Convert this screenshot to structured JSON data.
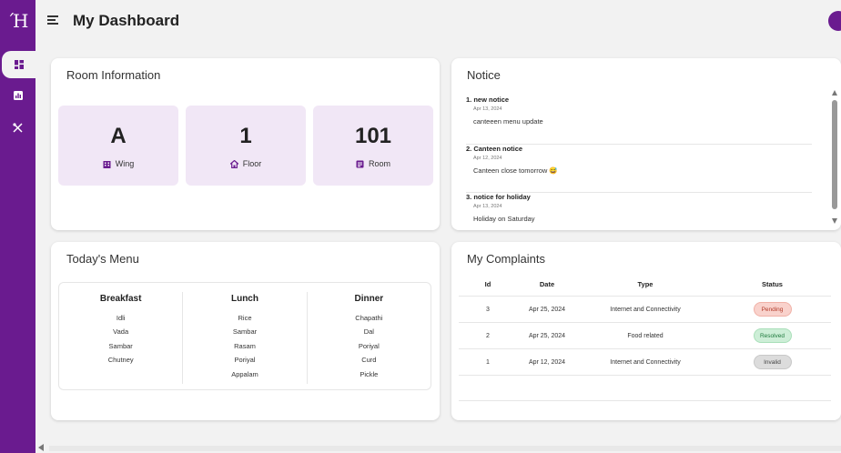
{
  "app": {
    "logo": "Ή",
    "page_title": "My Dashboard"
  },
  "sidebar": {
    "items": [
      {
        "icon": "dashboard-icon",
        "active": true
      },
      {
        "icon": "bar-chart-icon",
        "active": false
      },
      {
        "icon": "utensils-icon",
        "active": false
      }
    ]
  },
  "room": {
    "title": "Room Information",
    "tiles": [
      {
        "value": "A",
        "label": "Wing",
        "icon": "building-icon"
      },
      {
        "value": "1",
        "label": "Floor",
        "icon": "home-icon"
      },
      {
        "value": "101",
        "label": "Room",
        "icon": "room-icon"
      }
    ]
  },
  "notice": {
    "title": "Notice",
    "items": [
      {
        "title": "1. new notice",
        "date": "Apr 13, 2024",
        "body": "canteeen menu update"
      },
      {
        "title": "2. Canteen notice",
        "date": "Apr 12, 2024",
        "body": "Canteen close tomorrow 😅"
      },
      {
        "title": "3. notice for holiday",
        "date": "Apr 13, 2024",
        "body": "Holiday on Saturday"
      }
    ]
  },
  "menu": {
    "title": "Today's Menu",
    "columns": [
      {
        "heading": "Breakfast",
        "items": [
          "Idli",
          "Vada",
          "Sambar",
          "Chutney"
        ]
      },
      {
        "heading": "Lunch",
        "items": [
          "Rice",
          "Sambar",
          "Rasam",
          "Poriyal",
          "Appalam"
        ]
      },
      {
        "heading": "Dinner",
        "items": [
          "Chapathi",
          "Dal",
          "Poriyal",
          "Curd",
          "Pickle"
        ]
      }
    ]
  },
  "complaints": {
    "title": "My Complaints",
    "headers": [
      "Id",
      "Date",
      "Type",
      "Status"
    ],
    "rows": [
      {
        "id": "3",
        "date": "Apr 25, 2024",
        "type": "Internet and Connectivity",
        "status": "Pending"
      },
      {
        "id": "2",
        "date": "Apr 25, 2024",
        "type": "Food related",
        "status": "Resolved"
      },
      {
        "id": "1",
        "date": "Apr 12, 2024",
        "type": "Internet and Connectivity",
        "status": "Invalid"
      }
    ],
    "status_colors": {
      "Pending": {
        "bg": "#f9d2cc",
        "fg": "#b23b2a",
        "border": "#f0b1a7"
      },
      "Resolved": {
        "bg": "#cdeed7",
        "fg": "#1f7a3d",
        "border": "#a9dfb9"
      },
      "Invalid": {
        "bg": "#dcdcdc",
        "fg": "#444444",
        "border": "#c8c8c8"
      }
    }
  },
  "colors": {
    "brand": "#6a1b8f",
    "tile_bg": "#f1e7f6"
  }
}
